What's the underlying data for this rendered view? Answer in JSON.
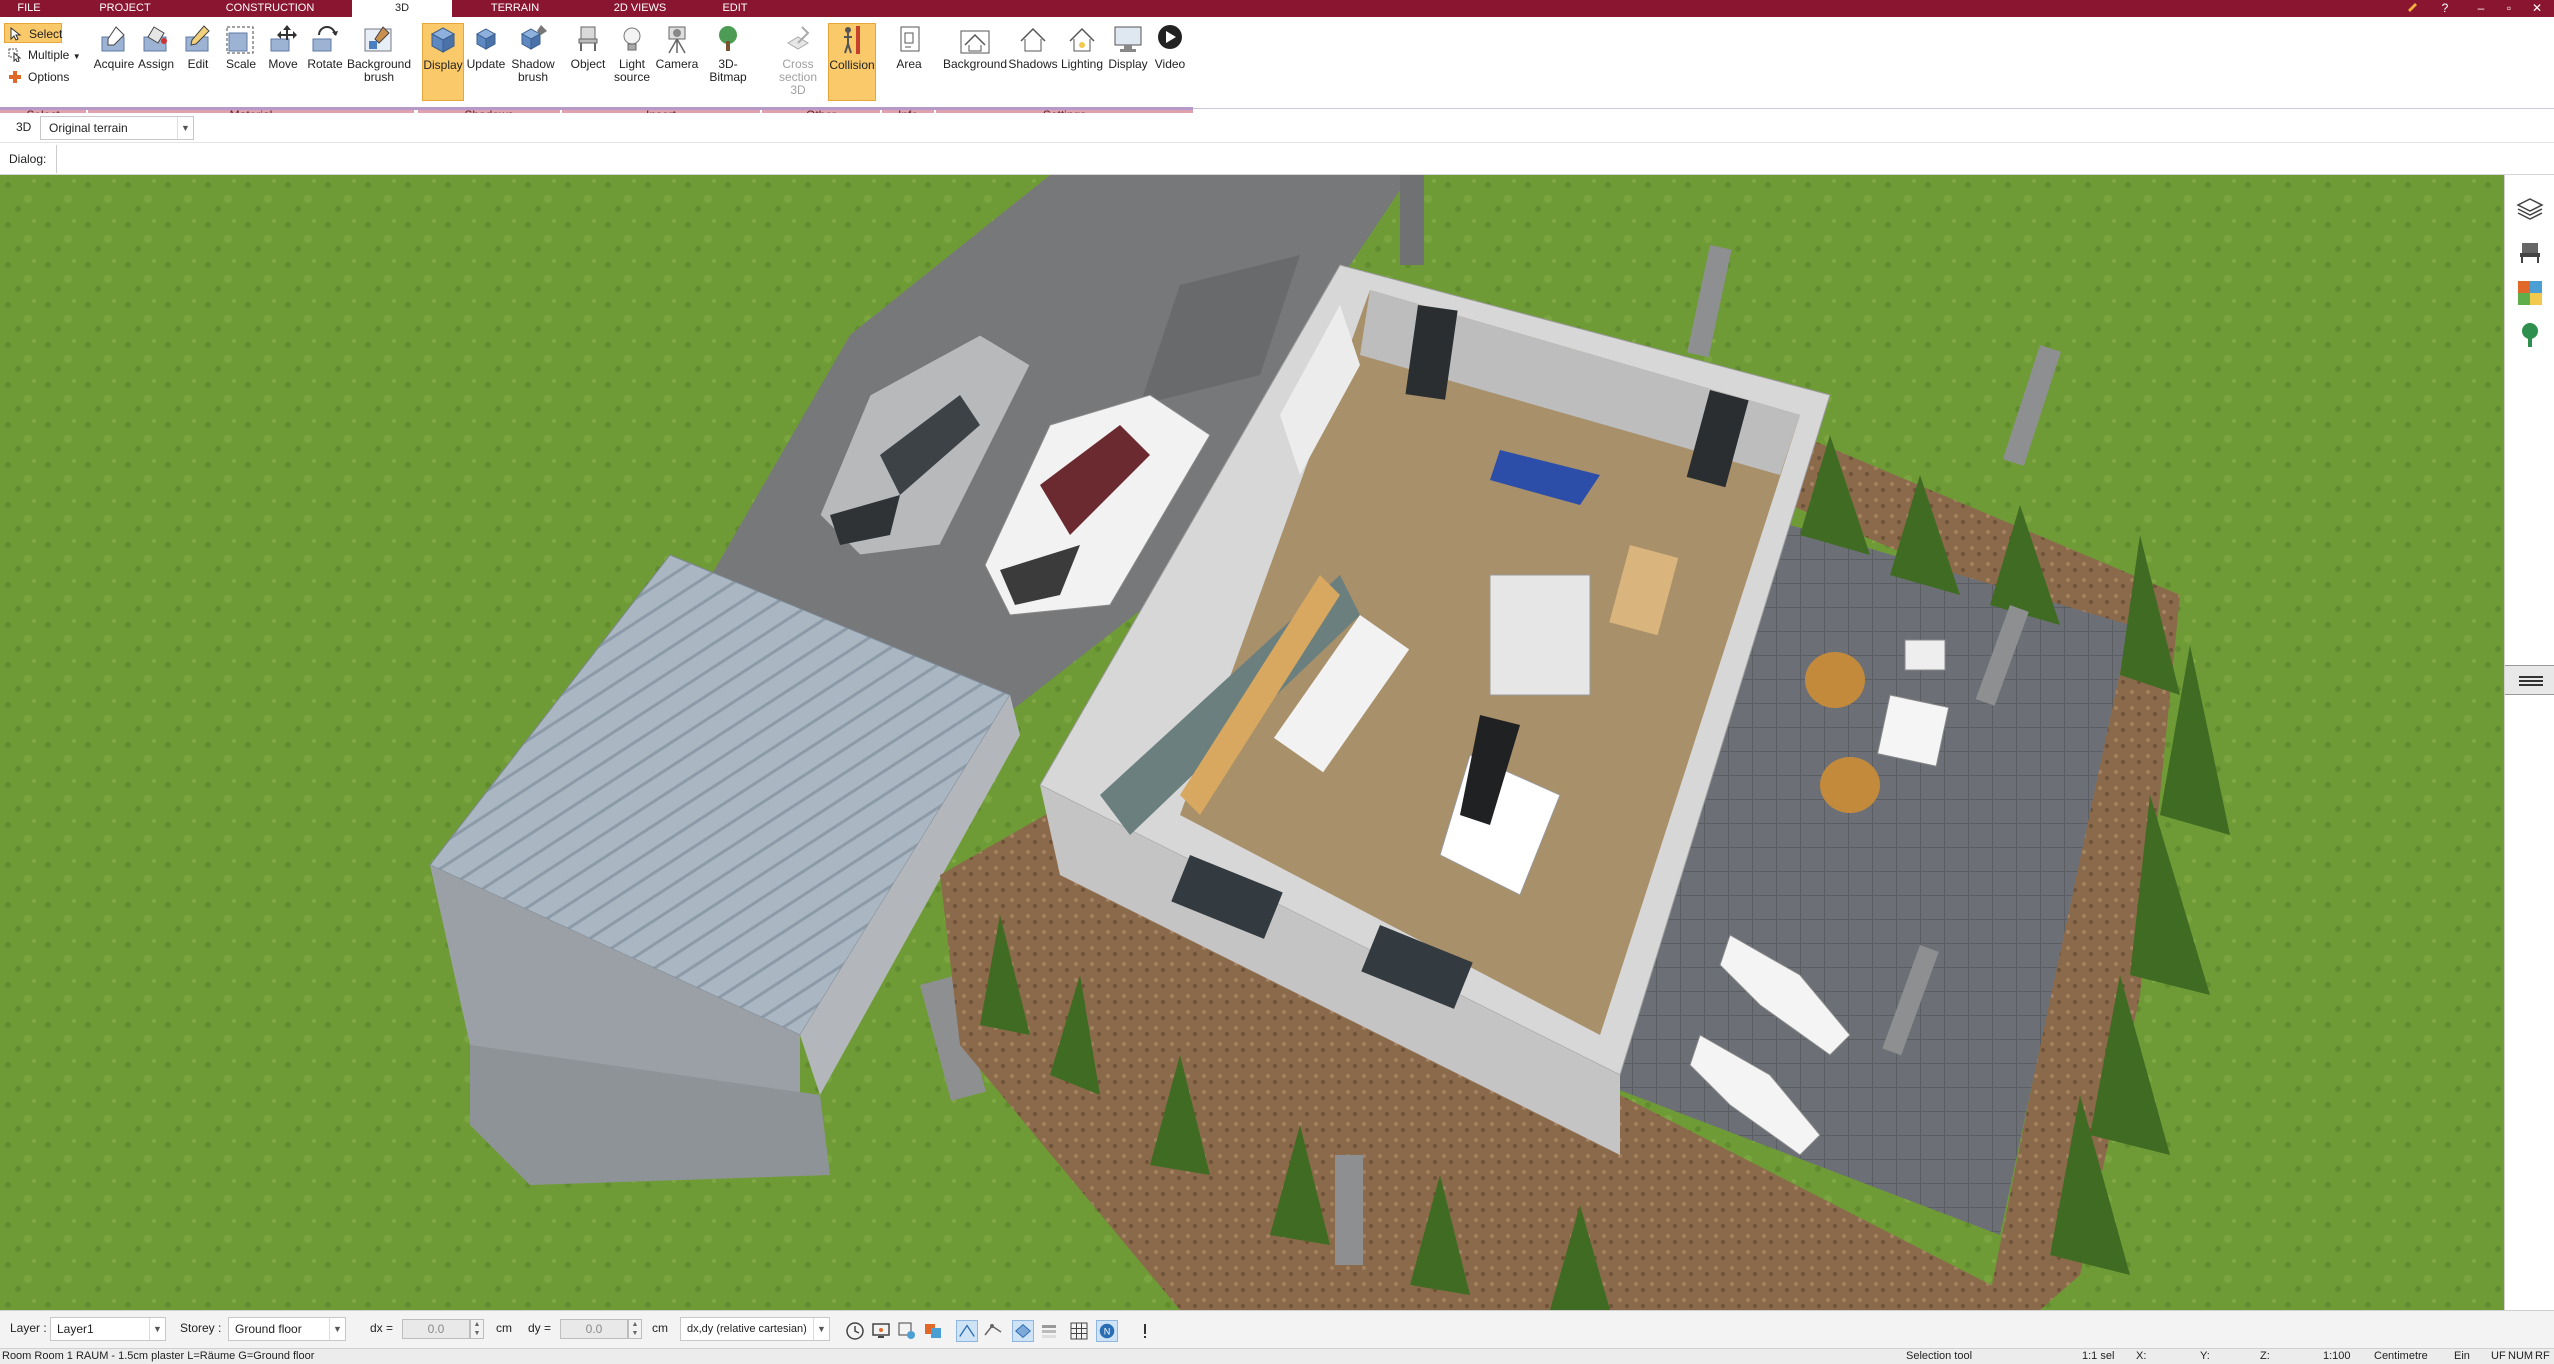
{
  "tabs": [
    "FILE",
    "PROJECT",
    "CONSTRUCTION",
    "3D",
    "TERRAIN",
    "2D VIEWS",
    "EDIT"
  ],
  "window_buttons": [
    "?",
    "–",
    "▫",
    "✕"
  ],
  "select_group": {
    "select_label": "Select",
    "multiple_label": "Multiple",
    "options_label": "Options",
    "group_label": "Select"
  },
  "ribbon": {
    "material": {
      "group_label": "Material",
      "buttons": [
        "Acquire",
        "Assign",
        "Edit",
        "Scale",
        "Move",
        "Rotate",
        "Background brush"
      ]
    },
    "shadows": {
      "group_label": "Shadows",
      "buttons": [
        "Display",
        "Update",
        "Shadow brush"
      ]
    },
    "insert": {
      "group_label": "Insert",
      "buttons": [
        "Object",
        "Light source",
        "Camera",
        "3D-Bitmap"
      ]
    },
    "other": {
      "group_label": "Other",
      "buttons": [
        "Cross section 3D",
        "Collision"
      ]
    },
    "info": {
      "group_label": "Info",
      "buttons": [
        "Area"
      ]
    },
    "settings": {
      "group_label": "Settings",
      "buttons": [
        "Background",
        "Shadows",
        "Lighting",
        "Display",
        "Video"
      ]
    }
  },
  "view_row": {
    "mode_label": "3D",
    "terrain_value": "Original terrain"
  },
  "dialog_row": {
    "label": "Dialog:"
  },
  "bottom": {
    "layer_label": "Layer :",
    "layer_value": "Layer1",
    "storey_label": "Storey :",
    "storey_value": "Ground floor",
    "dx_label": "dx =",
    "dx_value": "0.0",
    "dx_unit": "cm",
    "dy_label": "dy =",
    "dy_value": "0.0",
    "dy_unit": "cm",
    "coord_mode": "dx,dy (relative cartesian)"
  },
  "status": {
    "info": "Room Room 1 RAUM - 1.5cm plaster L=Räume G=Ground floor",
    "tool": "Selection tool",
    "sel": "1:1 sel",
    "x": "X:",
    "y": "Y:",
    "z": "Z:",
    "scale": "1:100",
    "unit": "Centimetre",
    "ein": "Ein",
    "uf": "UF",
    "num": "NUM",
    "rf": "RF"
  },
  "colors": {
    "tab_bar": "#8a1530",
    "group_label": "#dfa1ad",
    "active_button": "#f9c96a",
    "grass": "#6e9a36"
  }
}
